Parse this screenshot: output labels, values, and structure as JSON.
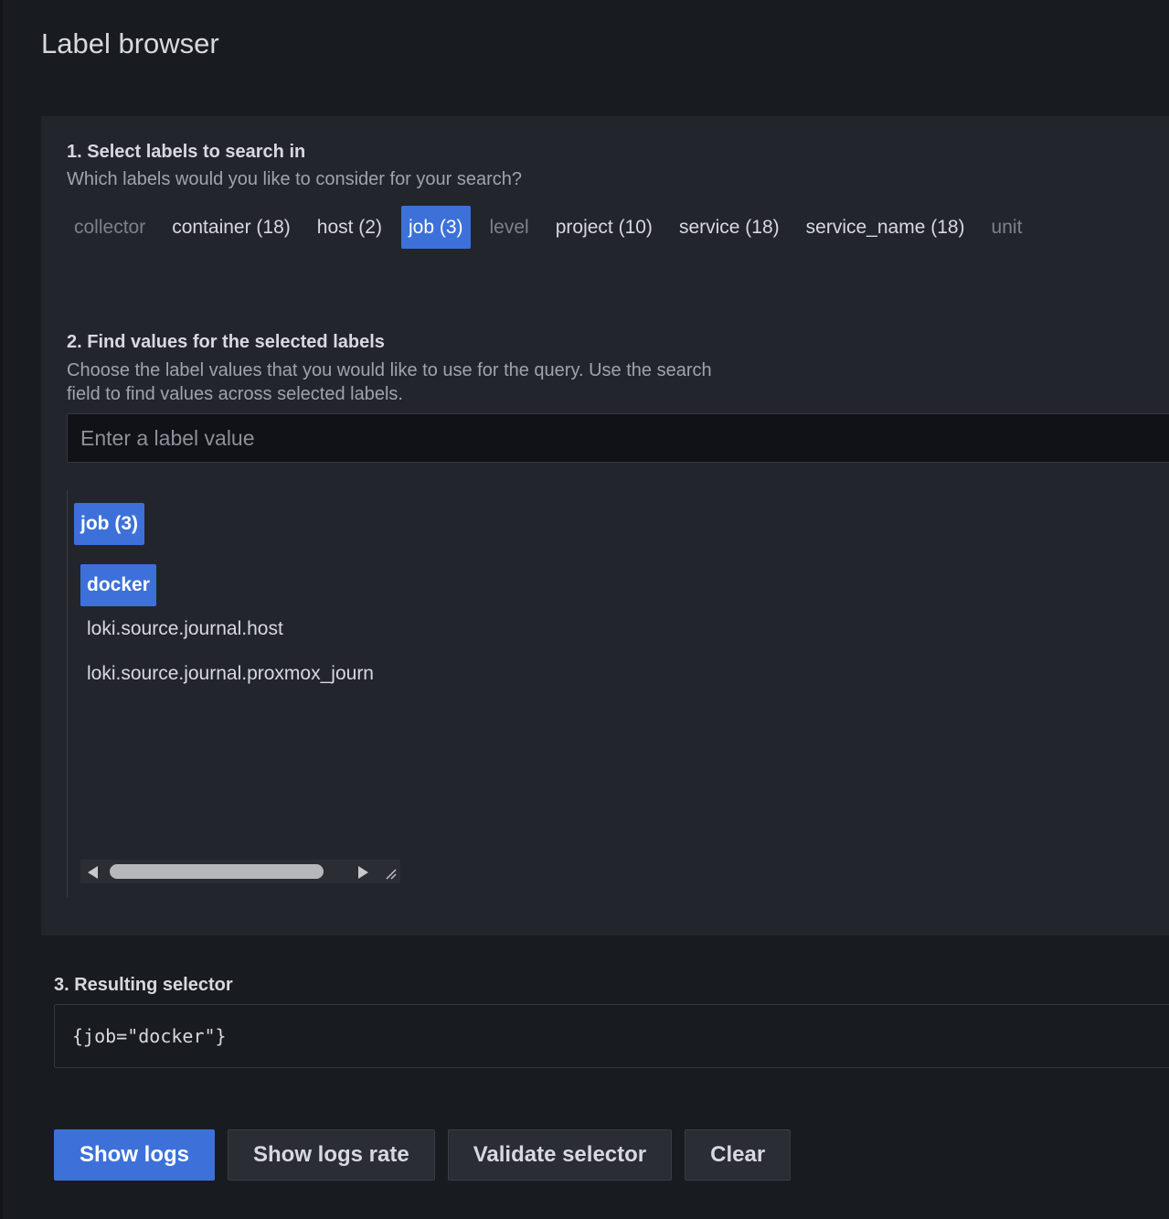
{
  "title": "Label browser",
  "step1": {
    "title": "1. Select labels to search in",
    "description": "Which labels would you like to consider for your search?",
    "labels": [
      {
        "text": "collector",
        "state": "muted"
      },
      {
        "text": "container (18)",
        "state": "normal"
      },
      {
        "text": "host (2)",
        "state": "normal"
      },
      {
        "text": "job (3)",
        "state": "selected"
      },
      {
        "text": "level",
        "state": "muted"
      },
      {
        "text": "project (10)",
        "state": "normal"
      },
      {
        "text": "service (18)",
        "state": "normal"
      },
      {
        "text": "service_name (18)",
        "state": "normal"
      },
      {
        "text": "unit",
        "state": "muted"
      }
    ]
  },
  "step2": {
    "title": "2. Find values for the selected labels",
    "description_line1": "Choose the label values that you would like to use for the query. Use the search",
    "description_line2": "field to find values across selected labels.",
    "search_placeholder": "Enter a label value",
    "search_value": "",
    "values_header": "job (3)",
    "values": [
      {
        "text": "docker",
        "selected": true
      },
      {
        "text": "loki.source.journal.host",
        "selected": false
      },
      {
        "text": "loki.source.journal.proxmox_journ",
        "selected": false
      }
    ]
  },
  "step3": {
    "title": "3. Resulting selector",
    "selector": "{job=\"docker\"}"
  },
  "buttons": {
    "show_logs": "Show logs",
    "show_logs_rate": "Show logs rate",
    "validate_selector": "Validate selector",
    "clear": "Clear"
  },
  "colors": {
    "accent": "#3d71d9",
    "background": "#181b1f",
    "panel": "#22252b"
  }
}
